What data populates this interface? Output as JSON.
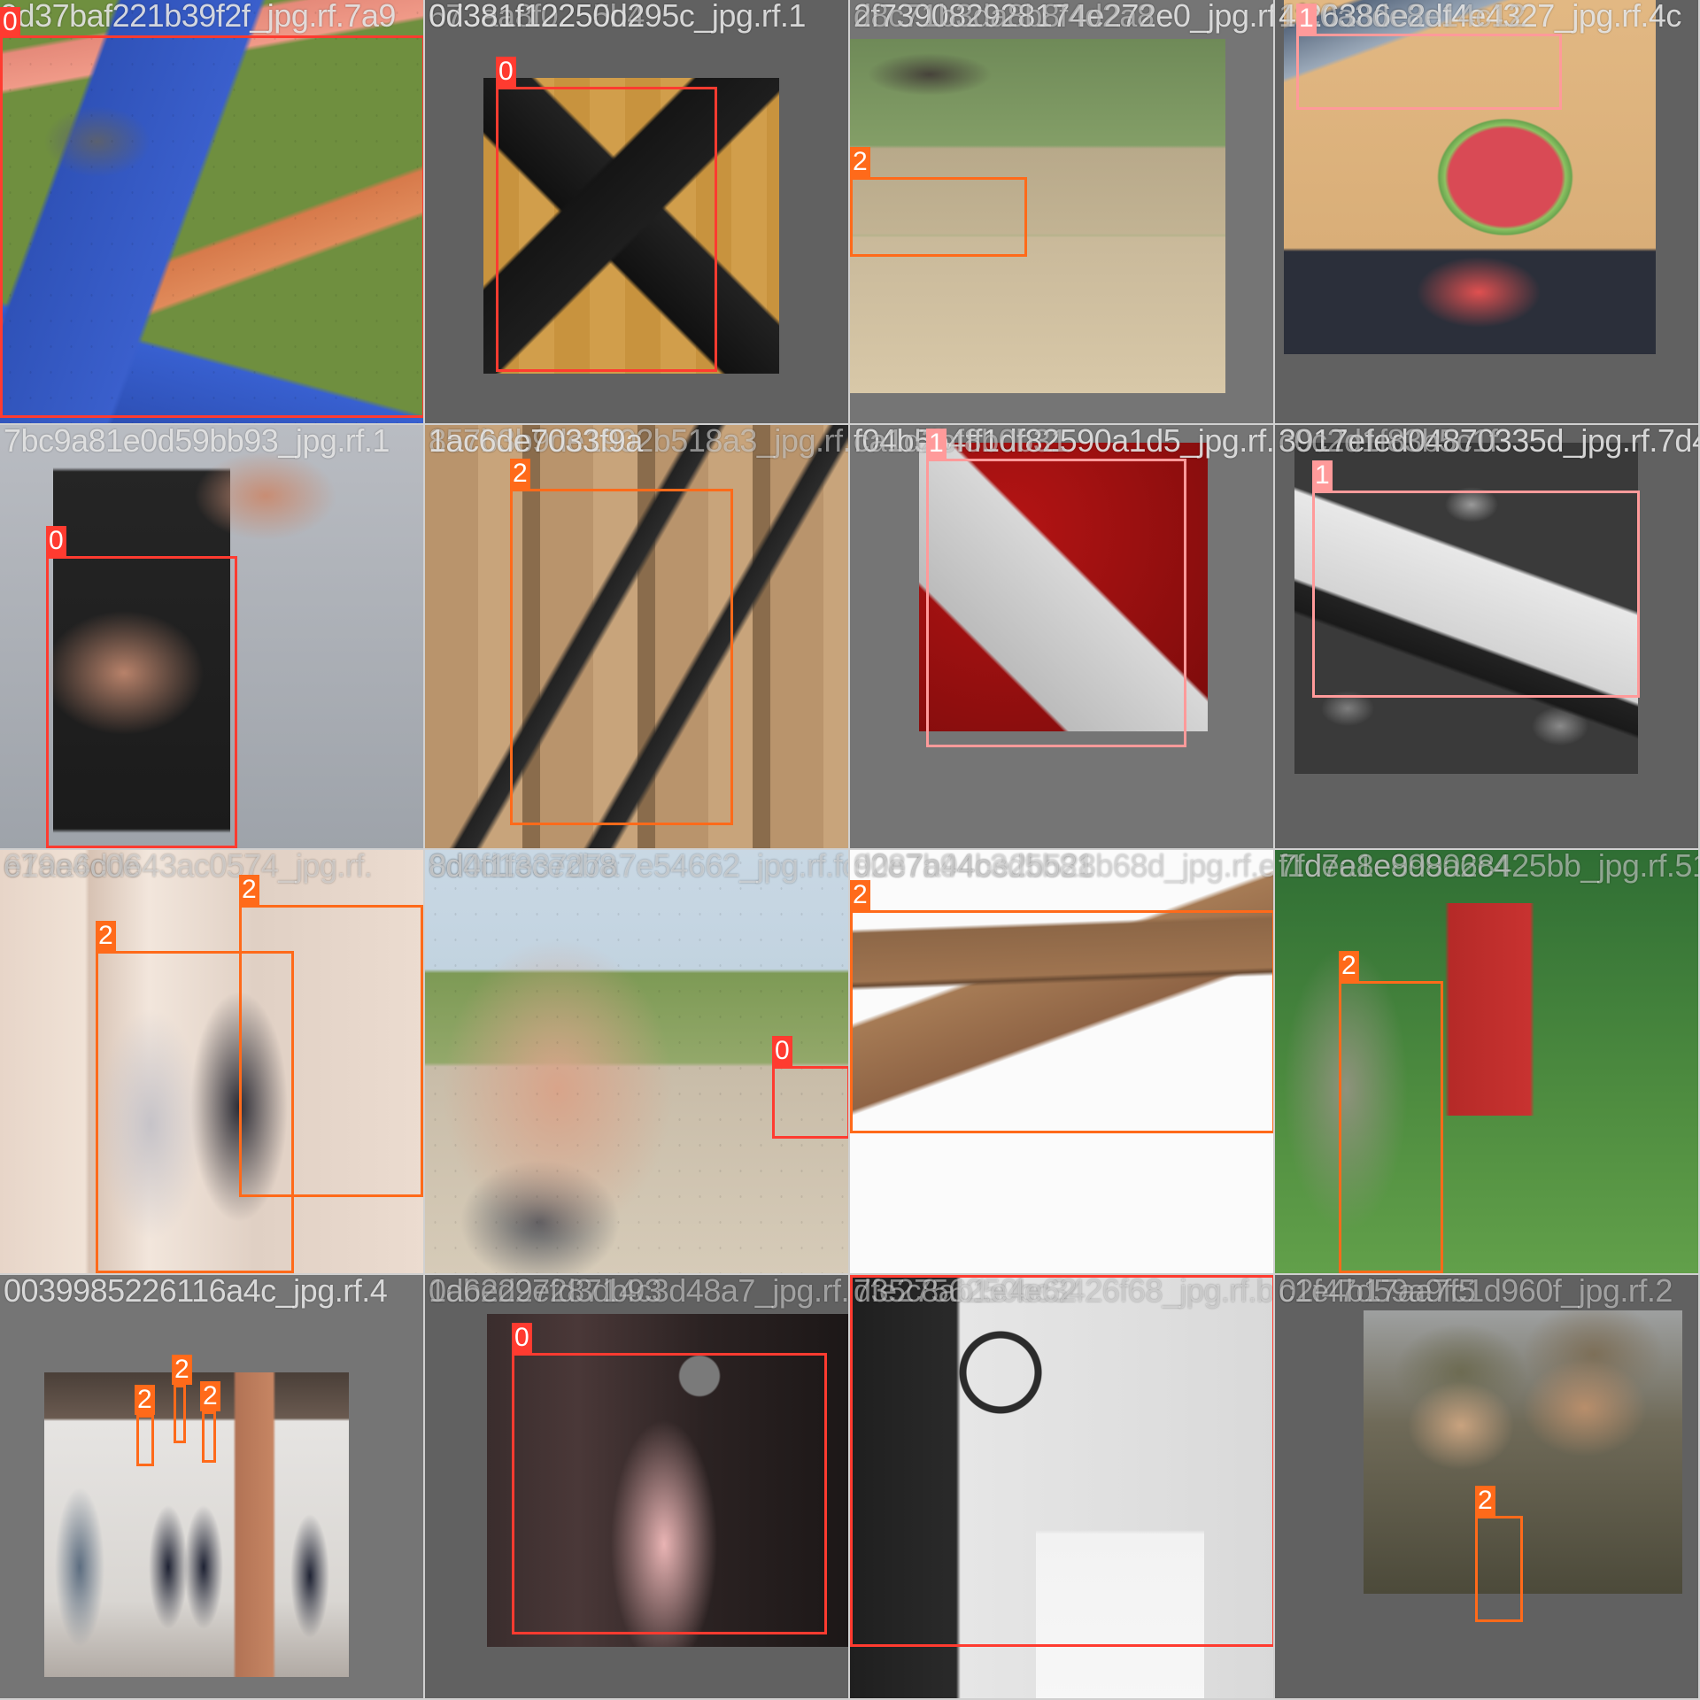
{
  "colors": {
    "class0": "#ff3b30",
    "class1": "#ff9a9a",
    "class2": "#ff6a1a",
    "filename_text": "#e8e8e8",
    "pad_dark": "#616161",
    "pad_mid": "#757575",
    "pad_light": "#8a8a8a"
  },
  "tiles": [
    {
      "filenames": [
        "0d37baf221b39f2f_jpg.rf.7a9"
      ],
      "scene": "blue-orange toy blaster pistol on green felt",
      "boxes": [
        {
          "class": "0"
        }
      ]
    },
    {
      "filenames": [
        "673aa8f0255b4",
        "0d381f12250d295c_jpg.rf.1"
      ],
      "scene": "black semi-automatic pistol on wooden board",
      "boxes": [
        {
          "class": "0"
        }
      ]
    },
    {
      "filenames": [
        "2f739082928174e272e0_jpg.rf.04",
        "d8c71b3da8b8f4d2a8"
      ],
      "scene": "soldier in armoured turret with mounted machine gun",
      "boxes": [
        {
          "class": "2"
        }
      ]
    },
    {
      "filenames": [
        "4f26386e2df4e4327_jpg.rf.4c",
        "1fc0a3de8e14c12"
      ],
      "scene": "kitchen knife on cutting board with watermelon",
      "boxes": [
        {
          "class": "1"
        }
      ]
    },
    {
      "filenames": [
        "7bc9a81e0d59bb93_jpg.rf.1"
      ],
      "scene": "hand loading magazine into pistol",
      "boxes": [
        {
          "class": "0"
        }
      ]
    },
    {
      "filenames": [
        "857b3b9de1902b518a3_jpg.rf.3",
        "1ac6de7033f9a"
      ],
      "scene": "row of people holding assault rifles",
      "boxes": [
        {
          "class": "2"
        }
      ]
    },
    {
      "filenames": [
        "f04b5b4ff1df82590a1d5_jpg.rf.07",
        "ca1d2bf8b0b31"
      ],
      "scene": "large knife blade on red velvet",
      "boxes": [
        {
          "class": "1"
        }
      ]
    },
    {
      "filenames": [
        "3917efed04870335d_jpg.rf.7d4f",
        "c0c2d1f83b5c1f"
      ],
      "scene": "black and white knife among potatoes",
      "boxes": [
        {
          "class": "1"
        }
      ]
    },
    {
      "filenames": [
        "679a4dd643ac0574_jpg.rf.",
        "e1ae6c0e"
      ],
      "scene": "couple holding shotguns at shooting range",
      "boxes": [
        {
          "class": "2"
        },
        {
          "class": "2"
        }
      ]
    },
    {
      "filenames": [
        "0d0d1e37d7a7e54662_jpg.rf.fc",
        "8d4f1f3ce2b8"
      ],
      "scene": "man with sunglasses firing pistol outdoors",
      "boxes": [
        {
          "class": "0"
        }
      ]
    },
    {
      "filenames": [
        "9287b94be2b528b68d_jpg.rf.ef",
        "d0e7a44c3d5b81"
      ],
      "scene": "bolt-action rifle with evidence tag on white",
      "boxes": [
        {
          "class": "2"
        }
      ]
    },
    {
      "filenames": [
        "7fd7e1e899028425bb_jpg.rf.51",
        "f1dea8e9d8a6c4"
      ],
      "scene": "soldier in camouflage aiming rifle at red target",
      "boxes": [
        {
          "class": "2"
        }
      ]
    },
    {
      "filenames": [
        "0039985226116a4c_jpg.rf.4"
      ],
      "scene": "tactical team entering training building",
      "boxes": [
        {
          "class": "2"
        },
        {
          "class": "2"
        },
        {
          "class": "2"
        }
      ]
    },
    {
      "filenames": [
        "0db2d2e28714c3d48a7_jpg.rf.2",
        "1a6e297fd3db93"
      ],
      "scene": "revolver in dim case",
      "boxes": [
        {
          "class": "0"
        }
      ]
    },
    {
      "filenames": [
        "7fe2756250bc3426f68_jpg.rf.b",
        "d35c8ab1e4e62"
      ],
      "scene": "pistol grip with forensic scale",
      "boxes": [
        {
          "class": "0"
        }
      ]
    },
    {
      "filenames": [
        "02f47d59a9fc1d960f_jpg.rf.2",
        "c1e4b17aa7f5"
      ],
      "scene": "group of helmeted soldiers",
      "boxes": [
        {
          "class": "2"
        }
      ]
    }
  ]
}
